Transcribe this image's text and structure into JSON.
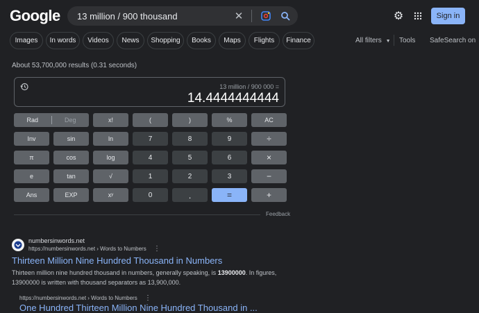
{
  "header": {
    "logo": "Google",
    "search_query": "13 million / 900 thousand",
    "signin_label": "Sign in"
  },
  "tabs": [
    "Images",
    "In words",
    "Videos",
    "News",
    "Shopping",
    "Books",
    "Maps",
    "Flights",
    "Finance"
  ],
  "tools": {
    "all_filters": "All filters",
    "tools": "Tools",
    "safesearch": "SafeSearch on"
  },
  "stats": "About 53,700,000 results (0.31 seconds)",
  "calculator": {
    "expression": "13 million / 900 000 =",
    "result": "14.4444444444",
    "keys": {
      "rad": "Rad",
      "deg": "Deg",
      "fact": "x!",
      "lparen": "(",
      "rparen": ")",
      "percent": "%",
      "ac": "AC",
      "inv": "Inv",
      "sin": "sin",
      "ln": "ln",
      "n7": "7",
      "n8": "8",
      "n9": "9",
      "div": "÷",
      "pi": "π",
      "cos": "cos",
      "log": "log",
      "n4": "4",
      "n5": "5",
      "n6": "6",
      "mul": "×",
      "e": "e",
      "tan": "tan",
      "sqrt": "√",
      "n1": "1",
      "n2": "2",
      "n3": "3",
      "minus": "−",
      "ans": "Ans",
      "exp": "EXP",
      "pow": "xʸ",
      "n0": "0",
      "dot": ".",
      "eq": "=",
      "plus": "+"
    },
    "feedback": "Feedback"
  },
  "result1": {
    "site_name": "numbersinwords.net",
    "url": "https://numbersinwords.net › Words to Numbers",
    "title": "Thirteen Million Nine Hundred Thousand in Numbers",
    "snippet_1": "Thirteen million nine hundred thousand in numbers, generally speaking, is ",
    "snippet_bold": "13900000",
    "snippet_2": ". In figures, 13900000 is written with thousand separators as 13,900,000."
  },
  "result2": {
    "url": "https://numbersinwords.net › Words to Numbers",
    "title": "One Hundred Thirteen Million Nine Hundred Thousand in ..."
  }
}
